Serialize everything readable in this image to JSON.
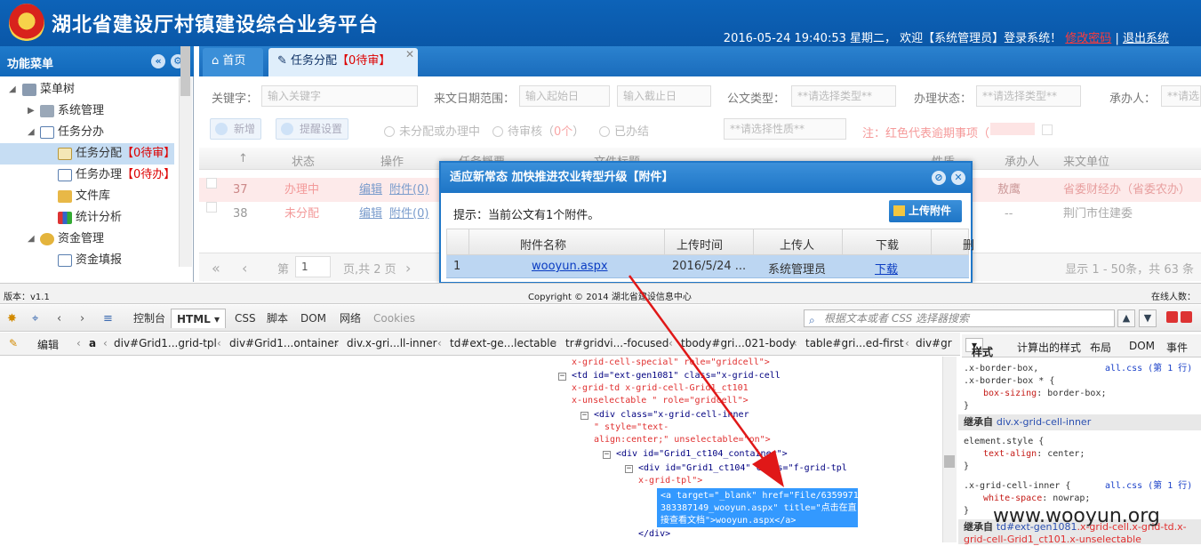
{
  "header": {
    "title": "湖北省建设厅村镇建设综合业务平台",
    "datetime": "2016-05-24 19:40:53 星期二，",
    "welcome": "欢迎【系统管理员】登录系统！",
    "change_password": "修改密码",
    "separator": "|",
    "logout": "退出系统"
  },
  "sidebar": {
    "title": "功能菜单",
    "items": [
      {
        "label": "菜单树"
      },
      {
        "label": "系统管理"
      },
      {
        "label": "任务分办"
      },
      {
        "label": "任务分配",
        "badge": "【0待审】"
      },
      {
        "label": "任务办理",
        "badge": "【0待办】"
      },
      {
        "label": "文件库"
      },
      {
        "label": "统计分析"
      },
      {
        "label": "资金管理"
      },
      {
        "label": "资金填报"
      }
    ]
  },
  "tabs": [
    {
      "label": "首页"
    },
    {
      "label": "任务分配",
      "badge": "【0待审】"
    }
  ],
  "filters": {
    "keyword_label": "关键字：",
    "keyword_placeholder": "输入关键字",
    "date_label": "来文日期范围：",
    "date_start_placeholder": "输入起始日",
    "date_end_placeholder": "输入截止日",
    "doc_type_label": "公文类型：",
    "doc_type_placeholder": "**请选择类型**",
    "status_label": "办理状态：",
    "status_placeholder": "**请选择类型**",
    "handler_label": "承办人：",
    "handler_placeholder": "**请选"
  },
  "toolbar": {
    "add_label": "新增",
    "remind_label": "提醒设置",
    "radio_unassigned": "未分配或办理中",
    "radio_pending": "待审核（",
    "radio_pending_count": "0个",
    "radio_pending_end": "）",
    "radio_done": "已办结",
    "nature_placeholder": "**请选择性质**",
    "note": "注：红色代表逾期事项（"
  },
  "grid": {
    "headers": [
      "状态",
      "操作",
      "任务概要",
      "文件标题",
      "性质",
      "承办人",
      "来文单位"
    ],
    "rows": [
      {
        "no": "37",
        "status": "办理中",
        "edit": "编辑",
        "attach": "附件(0)",
        "handler": "敖鹰",
        "unit": "省委财经办（省委农办）"
      },
      {
        "no": "38",
        "status": "未分配",
        "edit": "编辑",
        "attach": "附件(0)",
        "handler": "--",
        "unit": "荆门市住建委"
      }
    ]
  },
  "pager": {
    "page_label": "第",
    "page_value": "1",
    "page_total": "页,共 2 页",
    "summary": "显示 1 - 50条，共 63 条"
  },
  "modal": {
    "title": "适应新常态 加快推进农业转型升级【附件】",
    "tip": "提示：当前公文有1个附件。",
    "upload_label": "上传附件",
    "headers": [
      "附件名称",
      "上传时间",
      "上传人",
      "下载",
      "删"
    ],
    "rows": [
      {
        "no": "1",
        "name": "wooyun.aspx",
        "time": "2016/5/24 ...",
        "uploader": "系统管理员",
        "download": "下载"
      }
    ]
  },
  "statusbar": {
    "version": "版本：v1.1",
    "copyright": "Copyright © 2014 湖北省建设信息中心",
    "online": "在线人数："
  },
  "devtools": {
    "tabs": [
      "控制台",
      "HTML",
      "CSS",
      "脚本",
      "DOM",
      "网络",
      "Cookies"
    ],
    "search_placeholder": "根据文本或者 CSS 选择器搜索",
    "edit_label": "编辑",
    "crumbs": [
      "a",
      "div#Grid1...grid-tpl",
      "div#Grid1...ontainer",
      "div.x-gri...ll-inner",
      "td#ext-ge...lectable",
      "tr#gridvi...-focused",
      "tbody#gri...021-body",
      "table#gri...ed-first",
      "div#gr"
    ],
    "side_tabs": [
      "样式",
      "计算出的样式",
      "布局",
      "DOM",
      "事件"
    ],
    "html_lines": [
      "x-grid-cell-special\" role=\"gridcell\">",
      "<td id=\"ext-gen1081\" class=\"x-grid-cell",
      "x-grid-td x-grid-cell-Grid1_ct101",
      "x-unselectable \" role=\"gridcell\">",
      "<div class=\"x-grid-cell-inner",
      "\" style=\"text-",
      "align:center;\" unselectable=\"on\">",
      "<div id=\"Grid1_ct104_container\">",
      "<div id=\"Grid1_ct104\" class=\"f-grid-tpl",
      "x-grid-tpl\">",
      "</div>"
    ],
    "highlight": "<a target=\"_blank\" href=\"File/635997156\n383387149_wooyun.aspx\" title=\"点击在直\n接查看文档\">wooyun.aspx</a>",
    "styles": {
      "rule1_selector": ".x-border-box,",
      "rule1_source": "all.css (第 1 行)",
      "rule1_selector2": ".x-border-box * {",
      "rule1_prop": "box-sizing",
      "rule1_value": "border-box;",
      "inherit1_label": "继承自",
      "inherit1_target": "div.x-grid-cell-inner",
      "rule2_selector": "element.style {",
      "rule2_prop": "text-align",
      "rule2_value": "center;",
      "rule3_selector": ".x-grid-cell-inner {",
      "rule3_source": "all.css (第 1 行)",
      "rule3_prop": "white-space",
      "rule3_value": "nowrap;",
      "inherit2_label": "继承自",
      "inherit2_target": "td#ext-gen1081",
      "inherit2_rest": ".x-grid-cell.x-grid-td.x-",
      "inherit2_line2": "grid-cell-Grid1_ct101.x-unselectable"
    }
  },
  "watermark": "www.wooyun.org",
  "colors": {
    "brand_blue": "#0d63b8",
    "warning_red": "#d00000",
    "highlight_blue": "#3399ff",
    "arrow_red": "#e01818"
  }
}
